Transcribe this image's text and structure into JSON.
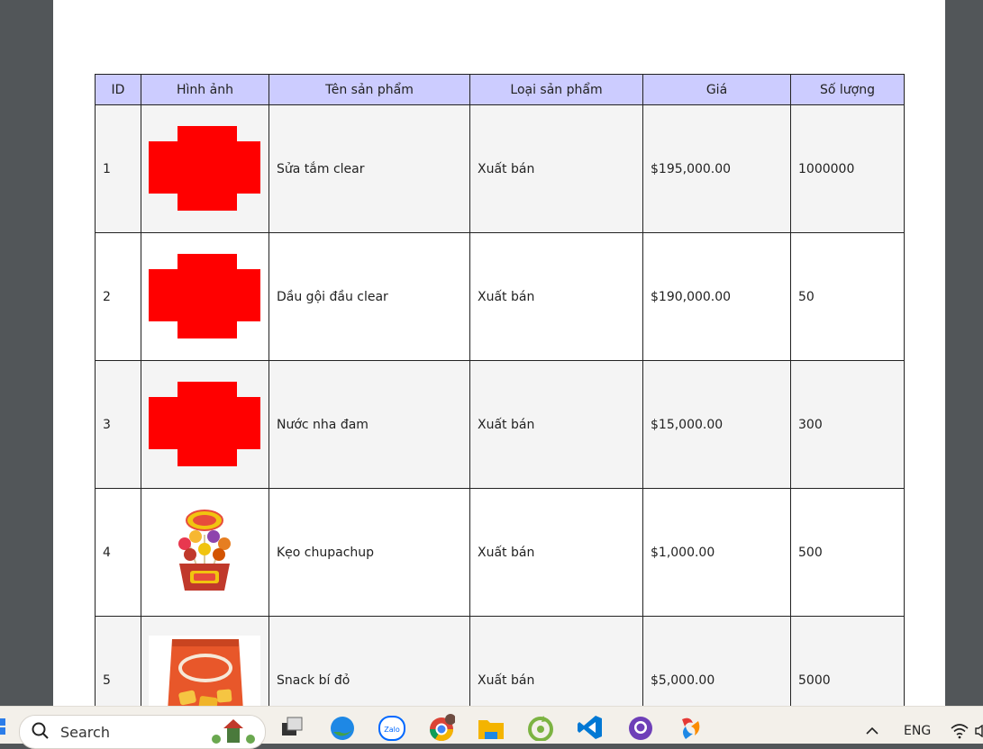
{
  "table": {
    "headers": [
      "ID",
      "Hình ảnh",
      "Tên sản phẩm",
      "Loại sản phẩm",
      "Giá",
      "Số lượng"
    ],
    "rows": [
      {
        "id": "1",
        "image": "missing-image-placeholder",
        "name": "Sửa tắm clear",
        "type": "Xuất bán",
        "price": "$195,000.00",
        "qty": "1000000"
      },
      {
        "id": "2",
        "image": "missing-image-placeholder",
        "name": "Dầu gội đầu clear",
        "type": "Xuất bán",
        "price": "$190,000.00",
        "qty": "50"
      },
      {
        "id": "3",
        "image": "missing-image-placeholder",
        "name": "Nước nha đam",
        "type": "Xuất bán",
        "price": "$15,000.00",
        "qty": "300"
      },
      {
        "id": "4",
        "image": "lollipop-product-photo",
        "name": "Kẹo chupachup",
        "type": "Xuất bán",
        "price": "$1,000.00",
        "qty": "500"
      },
      {
        "id": "5",
        "image": "snack-bag-product-photo",
        "name": "Snack bí đỏ",
        "type": "Xuất bán",
        "price": "$5,000.00",
        "qty": "5000"
      }
    ]
  },
  "taskbar": {
    "search_placeholder": "Search",
    "language": "ENG",
    "apps": [
      "file-explorer-icon",
      "edge-icon",
      "zalo-icon",
      "chrome-icon",
      "folder-icon",
      "coccoc-icon",
      "vscode-icon",
      "github-icon",
      "app-icon"
    ]
  },
  "colors": {
    "header_bg": "#ccccff",
    "row_alt_bg": "#f4f4f4",
    "placeholder_red": "#ff0000",
    "viewer_bg": "#525659"
  }
}
